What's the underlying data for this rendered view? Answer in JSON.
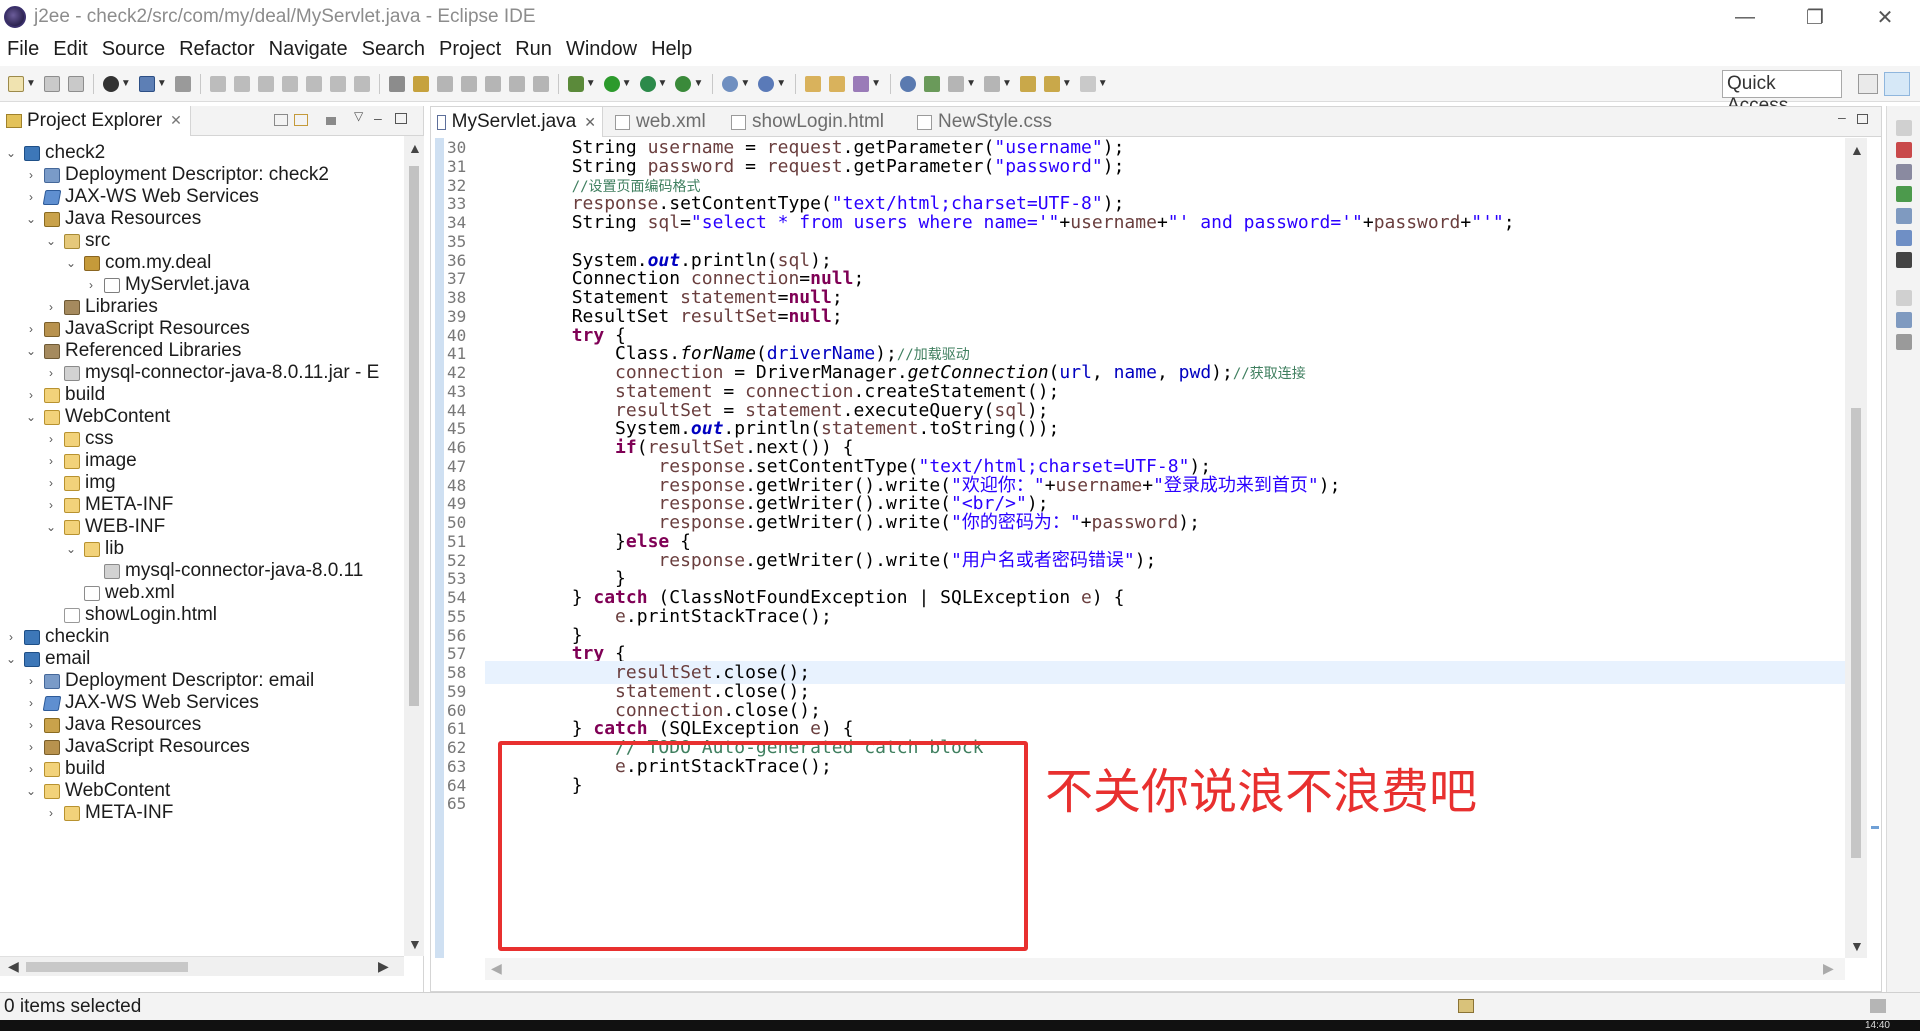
{
  "window": {
    "title": "j2ee - check2/src/com/my/deal/MyServlet.java - Eclipse IDE",
    "minimize": "—",
    "restore": "❐",
    "close": "✕"
  },
  "menu": [
    "File",
    "Edit",
    "Source",
    "Refactor",
    "Navigate",
    "Search",
    "Project",
    "Run",
    "Window",
    "Help"
  ],
  "toolbar": {
    "quick_access": "Quick Access"
  },
  "explorer": {
    "tab_label": "Project Explorer",
    "tab_close": "✕",
    "tree": [
      {
        "label": "check2",
        "depth": 0,
        "expanded": true,
        "icon": "project"
      },
      {
        "label": "Deployment Descriptor: check2",
        "depth": 1,
        "expanded": false,
        "icon": "dd"
      },
      {
        "label": "JAX-WS Web Services",
        "depth": 1,
        "expanded": false,
        "icon": "ws"
      },
      {
        "label": "Java Resources",
        "depth": 1,
        "expanded": true,
        "icon": "jres"
      },
      {
        "label": "src",
        "depth": 2,
        "expanded": true,
        "icon": "src"
      },
      {
        "label": "com.my.deal",
        "depth": 3,
        "expanded": true,
        "icon": "pkg"
      },
      {
        "label": "MyServlet.java",
        "depth": 4,
        "expanded": false,
        "icon": "java"
      },
      {
        "label": "Libraries",
        "depth": 2,
        "expanded": false,
        "icon": "lib"
      },
      {
        "label": "JavaScript Resources",
        "depth": 1,
        "expanded": false,
        "icon": "jsres"
      },
      {
        "label": "Referenced Libraries",
        "depth": 1,
        "expanded": true,
        "icon": "lib"
      },
      {
        "label": "mysql-connector-java-8.0.11.jar - E",
        "depth": 2,
        "expanded": false,
        "icon": "jar"
      },
      {
        "label": "build",
        "depth": 1,
        "expanded": false,
        "icon": "folder"
      },
      {
        "label": "WebContent",
        "depth": 1,
        "expanded": true,
        "icon": "folder"
      },
      {
        "label": "css",
        "depth": 2,
        "expanded": false,
        "icon": "folder"
      },
      {
        "label": "image",
        "depth": 2,
        "expanded": false,
        "icon": "folder"
      },
      {
        "label": "img",
        "depth": 2,
        "expanded": false,
        "icon": "folder"
      },
      {
        "label": "META-INF",
        "depth": 2,
        "expanded": false,
        "icon": "folder"
      },
      {
        "label": "WEB-INF",
        "depth": 2,
        "expanded": true,
        "icon": "folder"
      },
      {
        "label": "lib",
        "depth": 3,
        "expanded": true,
        "icon": "folder"
      },
      {
        "label": "mysql-connector-java-8.0.11",
        "depth": 4,
        "expanded": null,
        "icon": "jar"
      },
      {
        "label": "web.xml",
        "depth": 3,
        "expanded": null,
        "icon": "xml"
      },
      {
        "label": "showLogin.html",
        "depth": 2,
        "expanded": null,
        "icon": "html"
      },
      {
        "label": "checkin",
        "depth": 0,
        "expanded": false,
        "icon": "project"
      },
      {
        "label": "email",
        "depth": 0,
        "expanded": true,
        "icon": "project"
      },
      {
        "label": "Deployment Descriptor: email",
        "depth": 1,
        "expanded": false,
        "icon": "dd"
      },
      {
        "label": "JAX-WS Web Services",
        "depth": 1,
        "expanded": false,
        "icon": "ws"
      },
      {
        "label": "Java Resources",
        "depth": 1,
        "expanded": false,
        "icon": "jres"
      },
      {
        "label": "JavaScript Resources",
        "depth": 1,
        "expanded": false,
        "icon": "jsres"
      },
      {
        "label": "build",
        "depth": 1,
        "expanded": false,
        "icon": "folder"
      },
      {
        "label": "WebContent",
        "depth": 1,
        "expanded": true,
        "icon": "folder"
      },
      {
        "label": "META-INF",
        "depth": 2,
        "expanded": false,
        "icon": "folder"
      }
    ]
  },
  "editor": {
    "tabs": [
      {
        "label": "MyServlet.java",
        "active": true,
        "close": "✕"
      },
      {
        "label": "web.xml",
        "active": false
      },
      {
        "label": "showLogin.html",
        "active": false
      },
      {
        "label": "NewStyle.css",
        "active": false
      }
    ],
    "current_line": 58,
    "lines": [
      {
        "n": "30",
        "html": "        String <span class=\"lv\">username</span> = <span class=\"lv\">request</span>.getParameter(<span class=\"s\">\"username\"</span>);"
      },
      {
        "n": "31",
        "html": "        String <span class=\"lv\">password</span> = <span class=\"lv\">request</span>.getParameter(<span class=\"s\">\"password\"</span>);"
      },
      {
        "n": "32",
        "html": "        <span class=\"c\">//设置页面编码格式</span>"
      },
      {
        "n": "33",
        "html": "        <span class=\"lv\">response</span>.setContentType(<span class=\"s\">\"text/html;charset=UTF-8\"</span>);"
      },
      {
        "n": "34",
        "html": "        String <span class=\"lv\">sql</span>=<span class=\"s\">\"select * from users where name='\"</span>+<span class=\"lv\">username</span>+<span class=\"s\">\"' and password='\"</span>+<span class=\"lv\">password</span>+<span class=\"s\">\"'\"</span>;"
      },
      {
        "n": "35",
        "html": ""
      },
      {
        "n": "36",
        "html": "        System.<span class=\"sf\">out</span>.println(<span class=\"lv\">sql</span>);"
      },
      {
        "n": "37",
        "html": "        Connection <span class=\"lv\">connection</span>=<span class=\"k\">null</span>;"
      },
      {
        "n": "38",
        "html": "        Statement <span class=\"lv\">statement</span>=<span class=\"k\">null</span>;"
      },
      {
        "n": "39",
        "html": "        ResultSet <span class=\"lv\">resultSet</span>=<span class=\"k\">null</span>;"
      },
      {
        "n": "40",
        "html": "        <span class=\"k\">try</span> {"
      },
      {
        "n": "41",
        "html": "            Class.<span class=\"m\">forName</span>(<span class=\"f\">driverName</span>);<span class=\"c\">//加载驱动</span>"
      },
      {
        "n": "42",
        "html": "            <span class=\"lv\">connection</span> = DriverManager.<span class=\"m\">getConnection</span>(<span class=\"f\">url</span>, <span class=\"f\">name</span>, <span class=\"f\">pwd</span>);<span class=\"c\">//获取连接</span>"
      },
      {
        "n": "43",
        "html": "            <span class=\"lv\">statement</span> = <span class=\"lv\">connection</span>.createStatement();"
      },
      {
        "n": "44",
        "html": "            <span class=\"lv\">resultSet</span> = <span class=\"lv\">statement</span>.executeQuery(<span class=\"lv\">sql</span>);"
      },
      {
        "n": "45",
        "html": "            System.<span class=\"sf\">out</span>.println(<span class=\"lv\">statement</span>.toString());"
      },
      {
        "n": "46",
        "html": "            <span class=\"k\">if</span>(<span class=\"lv\">resultSet</span>.next()) {"
      },
      {
        "n": "47",
        "html": "                <span class=\"lv\">response</span>.setContentType(<span class=\"s\">\"text/html;charset=UTF-8\"</span>);"
      },
      {
        "n": "48",
        "html": "                <span class=\"lv\">response</span>.getWriter().write(<span class=\"s\">\"<span style=\\\"font-size:14px\\\">欢迎你：</span>\"</span>+<span class=\"lv\">username</span>+<span class=\"s\">\"<span style=\\\"font-size:14px\\\">登录成功来到首页</span>\"</span>);"
      },
      {
        "n": "49",
        "html": "                <span class=\"lv\">response</span>.getWriter().write(<span class=\"s\">\"&lt;br/&gt;\"</span>);"
      },
      {
        "n": "50",
        "html": "                <span class=\"lv\">response</span>.getWriter().write(<span class=\"s\">\"<span style=\\\"font-size:14px\\\">你的密码为：</span>\"</span>+<span class=\"lv\">password</span>);"
      },
      {
        "n": "51",
        "html": "            }<span class=\"k\">else</span> {"
      },
      {
        "n": "52",
        "html": "                <span class=\"lv\">response</span>.getWriter().write(<span class=\"s\">\"<span style=\\\"font-size:14px\\\">用户名或者密码错误</span>\"</span>);"
      },
      {
        "n": "53",
        "html": "            }"
      },
      {
        "n": "54",
        "html": "        } <span class=\"k\">catch</span> (ClassNotFoundException | SQLException <span class=\"lv\">e</span>) {"
      },
      {
        "n": "55",
        "html": "            <span class=\"lv\">e</span>.printStackTrace();"
      },
      {
        "n": "56",
        "html": "        }"
      },
      {
        "n": "57",
        "html": "        <span class=\"k\">try</span> {"
      },
      {
        "n": "58",
        "html": "            <span class=\"lv\">resultSet</span>.close();"
      },
      {
        "n": "59",
        "html": "            <span class=\"lv\">statement</span>.close();"
      },
      {
        "n": "60",
        "html": "            <span class=\"lv\">connection</span>.close();"
      },
      {
        "n": "61",
        "html": "        } <span class=\"k\">catch</span> (SQLException <span class=\"lv\">e</span>) {"
      },
      {
        "n": "62",
        "html": "            <span class=\"cm\">// TODO Auto-generated catch block</span>"
      },
      {
        "n": "63",
        "html": "            <span class=\"lv\">e</span>.printStackTrace();"
      },
      {
        "n": "64",
        "html": "        }"
      },
      {
        "n": "65",
        "html": ""
      }
    ]
  },
  "annotation": {
    "text": "不关你说浪不浪费吧",
    "color": "#e8302f"
  },
  "status": {
    "text": "0 items selected"
  },
  "taskbar": {
    "time": "14:40"
  }
}
